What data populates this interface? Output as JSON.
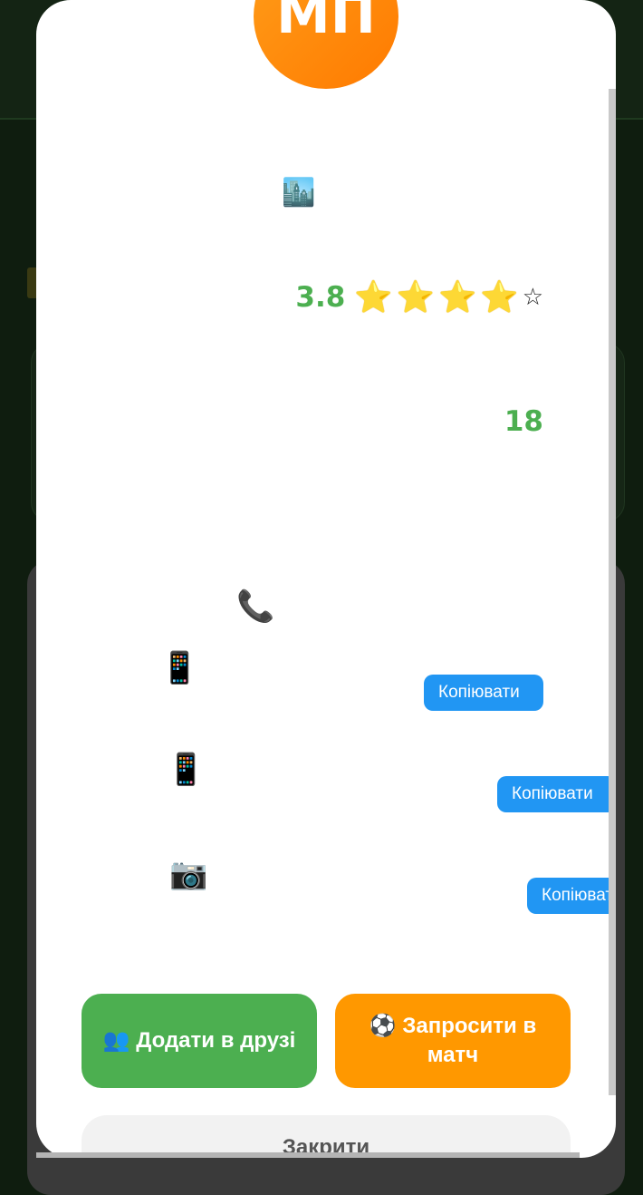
{
  "avatar": {
    "initials": "МП",
    "gradient": [
      "#ff9d19",
      "#ff7a00"
    ]
  },
  "icons": {
    "city": "🏙️",
    "phone": "📞",
    "mobile": "📱",
    "camera": "📷",
    "friends": "👥",
    "ball": "⚽"
  },
  "rating": {
    "value": "3.8",
    "stars_full": 4,
    "stars_total": 5,
    "full_star": "⭐",
    "empty_star": "☆"
  },
  "count": {
    "value": "18"
  },
  "contacts": [
    {
      "copy_label": "Копіювати"
    },
    {
      "copy_label": "Копіювати"
    },
    {
      "copy_label": "Копіювати"
    }
  ],
  "actions": {
    "add_friend_label": "👥 Додати в друзі",
    "invite_label": "⚽ Запросити в матч",
    "close_label": "Закрити"
  },
  "colors": {
    "accent_green": "#4caf50",
    "accent_orange": "#ff9800",
    "accent_blue": "#2196f3"
  }
}
